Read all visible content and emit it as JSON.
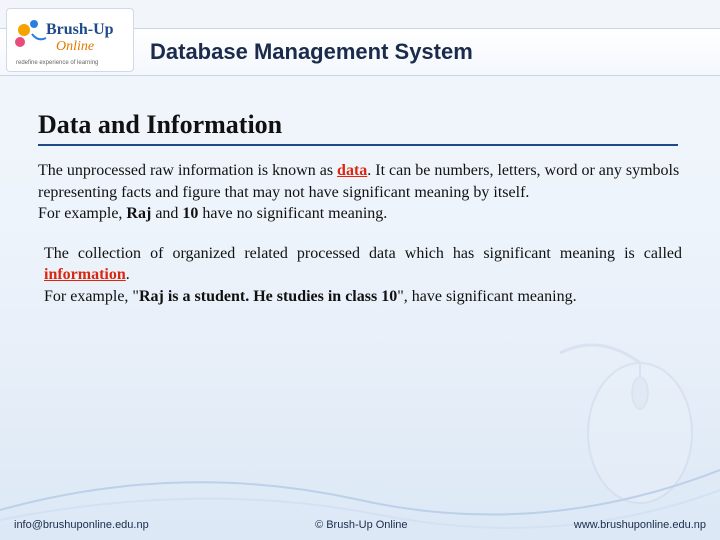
{
  "logo": {
    "line1": "Brush-Up",
    "line2": "Online",
    "tagline": "redefine experience of learning"
  },
  "header": {
    "title": "Database Management System"
  },
  "content": {
    "heading": "Data and Information",
    "p1a": "The unprocessed raw information is known as ",
    "p1_kw": "data",
    "p1b": ". It can be numbers, letters, word or any symbols representing facts and figure that may not have significant meaning by itself.",
    "p1c_prefix": "For example, ",
    "p1c_bold": "Raj",
    "p1c_mid": " and ",
    "p1c_bold2": "10",
    "p1c_suffix": " have no significant meaning.",
    "p2a": "The collection of organized related processed data which has significant meaning is called ",
    "p2_kw": "information",
    "p2b": ".",
    "p2c_prefix": "For example, \"",
    "p2c_bold": "Raj is a student. He studies in class 10",
    "p2c_suffix": "\", have significant meaning."
  },
  "footer": {
    "email": "info@brushuponline.edu.np",
    "copyright": "© Brush-Up Online",
    "website": "www.brushuponline.edu.np"
  }
}
